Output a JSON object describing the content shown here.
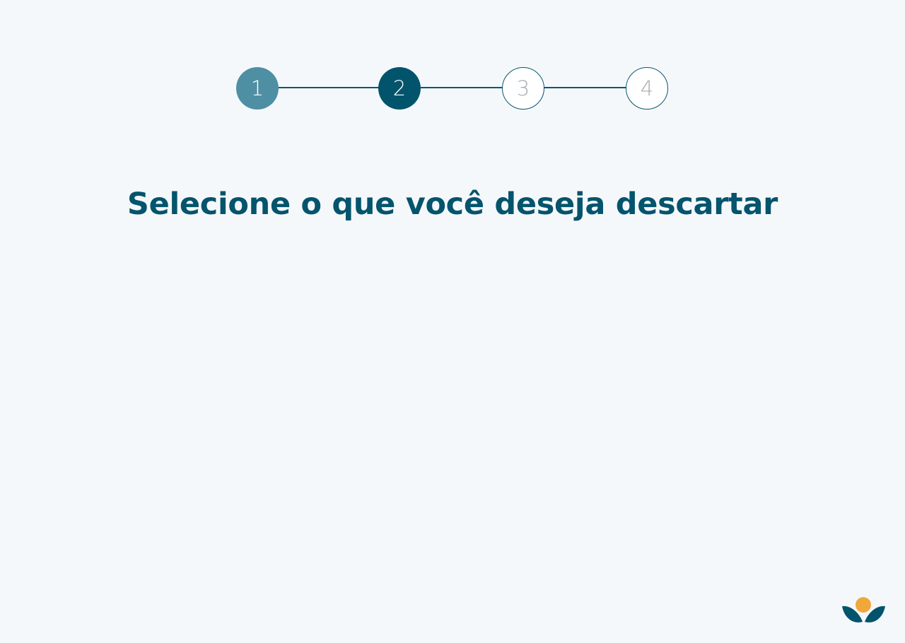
{
  "stepper": {
    "steps": [
      {
        "label": "1",
        "state": "done"
      },
      {
        "label": "2",
        "state": "active"
      },
      {
        "label": "3",
        "state": "pending"
      },
      {
        "label": "4",
        "state": "pending"
      }
    ]
  },
  "page": {
    "title": "Selecione o que você deseja descartar"
  },
  "colors": {
    "primary": "#02546c",
    "step_done": "#4e8fa3",
    "accent": "#f0a83a",
    "background": "#f5f8fb"
  },
  "logo": {
    "icon": "sprout-sun-logo-icon"
  }
}
